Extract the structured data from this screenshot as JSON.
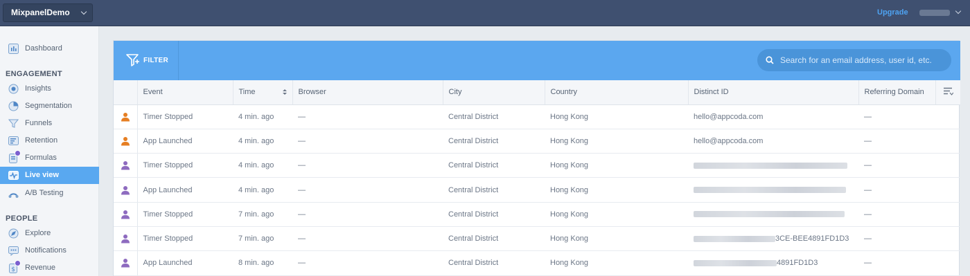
{
  "topbar": {
    "project_name": "MixpanelDemo",
    "upgrade_label": "Upgrade"
  },
  "sidebar": {
    "dashboard": "Dashboard",
    "engagement_title": "ENGAGEMENT",
    "engagement_items": [
      "Insights",
      "Segmentation",
      "Funnels",
      "Retention",
      "Formulas",
      "Live view",
      "A/B Testing"
    ],
    "people_title": "PEOPLE",
    "people_items": [
      "Explore",
      "Notifications",
      "Revenue"
    ],
    "active_item": "Live view"
  },
  "header": {
    "filter_label": "FILTER",
    "search_placeholder": "Search for an email address, user id, etc."
  },
  "table": {
    "columns": [
      "Event",
      "Time",
      "Browser",
      "City",
      "Country",
      "Distinct ID",
      "Referring Domain"
    ],
    "rows": [
      {
        "avatar_color": "#e67e22",
        "event": "Timer Stopped",
        "time": "4 min. ago",
        "browser": "—",
        "city": "Central District",
        "country": "Hong Kong",
        "distinct_id": "hello@appcoda.com",
        "referring_domain": "—"
      },
      {
        "avatar_color": "#e67e22",
        "event": "App Launched",
        "time": "4 min. ago",
        "browser": "—",
        "city": "Central District",
        "country": "Hong Kong",
        "distinct_id": "hello@appcoda.com",
        "referring_domain": "—"
      },
      {
        "avatar_color": "#8e6bbf",
        "event": "Timer Stopped",
        "time": "4 min. ago",
        "browser": "—",
        "city": "Central District",
        "country": "Hong Kong",
        "distinct_id": "",
        "referring_domain": "—"
      },
      {
        "avatar_color": "#8e6bbf",
        "event": "App Launched",
        "time": "4 min. ago",
        "browser": "—",
        "city": "Central District",
        "country": "Hong Kong",
        "distinct_id": "",
        "referring_domain": "—"
      },
      {
        "avatar_color": "#8e6bbf",
        "event": "Timer Stopped",
        "time": "7 min. ago",
        "browser": "—",
        "city": "Central District",
        "country": "Hong Kong",
        "distinct_id": "",
        "referring_domain": "—"
      },
      {
        "avatar_color": "#8e6bbf",
        "event": "Timer Stopped",
        "time": "7 min. ago",
        "browser": "—",
        "city": "Central District",
        "country": "Hong Kong",
        "distinct_id": "3CE-BEE4891FD1D3",
        "referring_domain": "—"
      },
      {
        "avatar_color": "#8e6bbf",
        "event": "App Launched",
        "time": "8 min. ago",
        "browser": "—",
        "city": "Central District",
        "country": "Hong Kong",
        "distinct_id": "4891FD1D3",
        "referring_domain": "—"
      }
    ]
  },
  "colors": {
    "topbar": "#3f5070",
    "accent_blue": "#5ba7ef",
    "active_nav": "#59a8f0",
    "upgrade_link": "#4ea3f2"
  }
}
